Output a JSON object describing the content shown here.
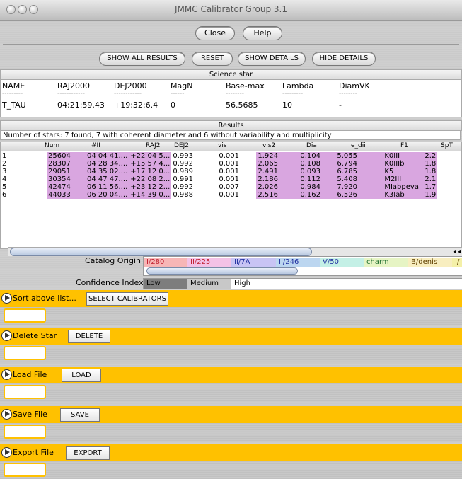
{
  "window": {
    "title": "JMMC Calibrator Group 3.1"
  },
  "top_buttons": {
    "close": "Close",
    "help": "Help"
  },
  "toolbar": {
    "show_all": "SHOW ALL RESULTS",
    "reset": "RESET",
    "show_details": "SHOW DETAILS",
    "hide_details": "HIDE DETAILS"
  },
  "science": {
    "title": "Science star",
    "headers": [
      "NAME",
      "RAJ2000",
      "DEJ2000",
      "MagN",
      "Base-max",
      "Lambda",
      "DiamVK"
    ],
    "dashes": [
      "---------",
      "------------",
      "------------",
      "------",
      "--------",
      "---------",
      "--------"
    ],
    "row": [
      "T_TAU",
      "04:21:59.43",
      "+19:32:6.4",
      "0",
      "56.5685",
      "10",
      "-"
    ]
  },
  "results": {
    "title": "Results",
    "summary": "Number of stars: 7 found, 7 with coherent diameter and 6 without variability and multiplicity",
    "columns": [
      "Num",
      "#II",
      "RAJ2",
      "DEJ2",
      "vis",
      "vis2",
      "Dia",
      "e_dii",
      "F1",
      "SpT"
    ],
    "rows": [
      [
        "1",
        "25604",
        "04 04 41....",
        "+22 04 5...",
        "0.993",
        "0.001",
        "1.924",
        "0.104",
        "5.055",
        "K0III",
        "2.2"
      ],
      [
        "2",
        "28307",
        "04 28 34....",
        "+15 57 4...",
        "0.992",
        "0.001",
        "2.065",
        "0.108",
        "6.794",
        "K0IIIb",
        "1.8"
      ],
      [
        "3",
        "29051",
        "04 35 02....",
        "+17 12 0...",
        "0.989",
        "0.001",
        "2.491",
        "0.093",
        "6.785",
        "K5",
        "1.8"
      ],
      [
        "4",
        "30354",
        "04 47 47....",
        "+22 08 2...",
        "0.991",
        "0.001",
        "2.186",
        "0.112",
        "5.408",
        "M2III",
        "2.1"
      ],
      [
        "5",
        "42474",
        "06 11 56....",
        "+23 12 2...",
        "0.992",
        "0.007",
        "2.026",
        "0.984",
        "7.920",
        "MIabpeva",
        "1.7"
      ],
      [
        "6",
        "44033",
        "06 20 04....",
        "+14 39 0...",
        "0.988",
        "0.001",
        "2.516",
        "0.162",
        "6.526",
        "K3Iab",
        "1.9"
      ]
    ]
  },
  "catalog": {
    "label": "Catalog Origin",
    "items": [
      "I/280",
      "II/225",
      "II/7A",
      "II/246",
      "V/50",
      "charm",
      "B/denis",
      "I/"
    ],
    "colors": [
      "#f7b6b6",
      "#f3c2e6",
      "#c8c4f4",
      "#bcd6f0",
      "#c4f0e6",
      "#e6f4c4",
      "#f8eec0",
      "#f4f0a8"
    ]
  },
  "confidence": {
    "label": "Confidence Index",
    "items": [
      "Low",
      "Medium",
      "High"
    ]
  },
  "actions": [
    {
      "label": "Sort above list...",
      "button": "SELECT CALIBRATORS"
    },
    {
      "label": "Delete Star",
      "button": "DELETE"
    },
    {
      "label": "Load File",
      "button": "LOAD"
    },
    {
      "label": "Save File",
      "button": "SAVE"
    },
    {
      "label": "Export File",
      "button": "EXPORT"
    }
  ]
}
